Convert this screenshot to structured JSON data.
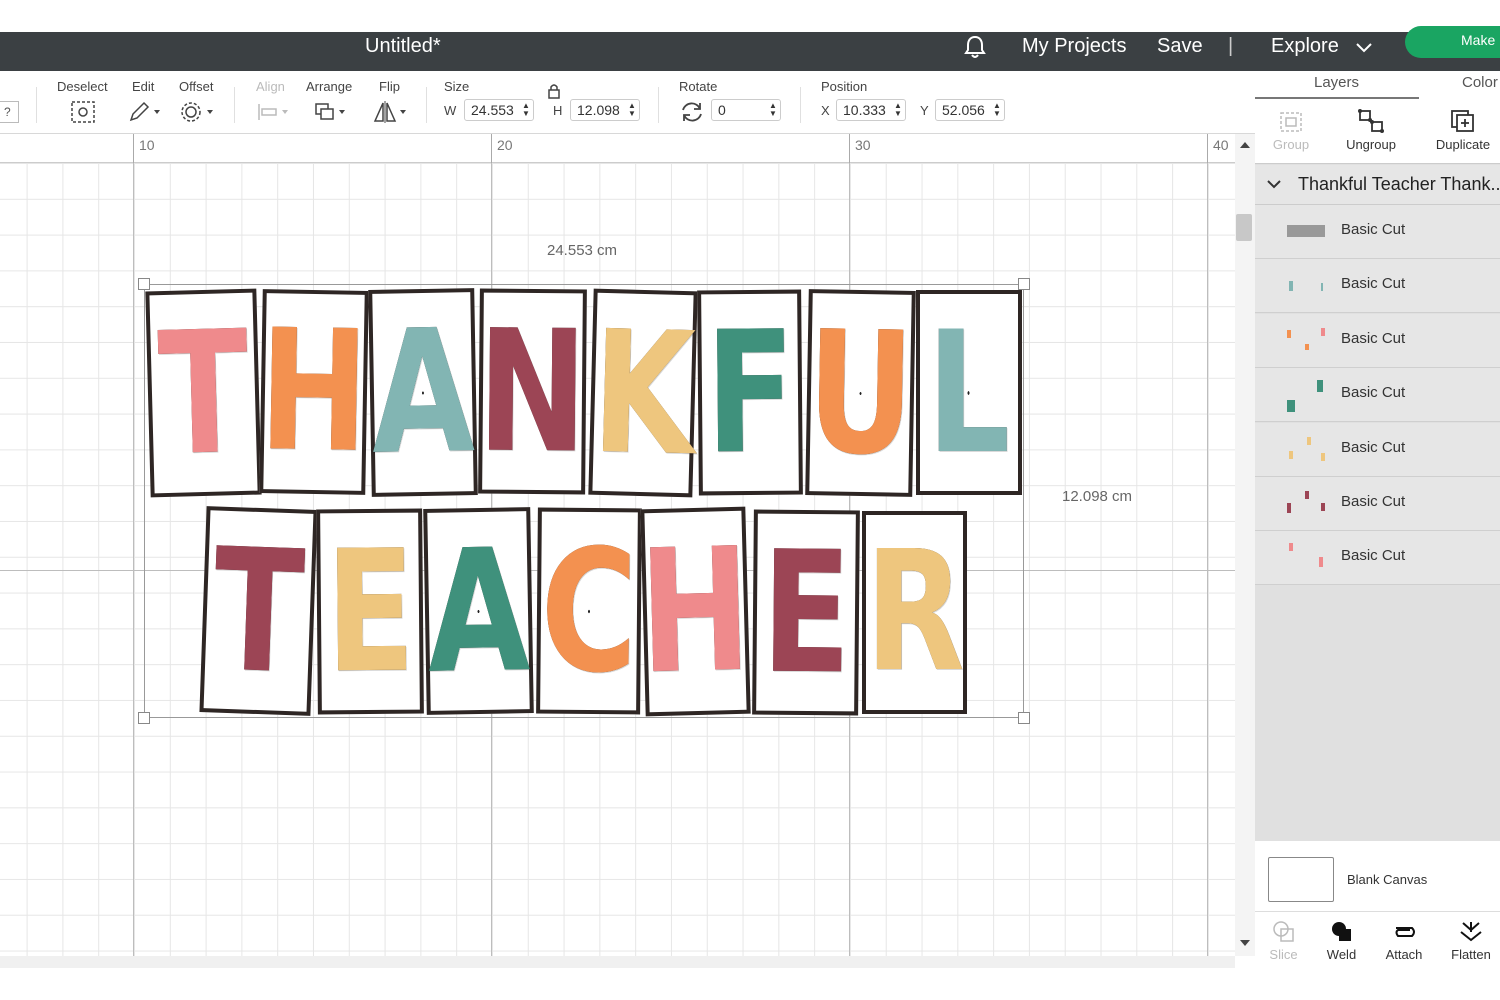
{
  "header": {
    "title": "Untitled*",
    "my_projects": "My Projects",
    "save": "Save",
    "explore": "Explore",
    "make": "Make"
  },
  "toolbar": {
    "help": "?",
    "deselect": "Deselect",
    "edit": "Edit",
    "offset": "Offset",
    "align": "Align",
    "arrange": "Arrange",
    "flip": "Flip",
    "size": "Size",
    "w_label": "W",
    "w_value": "24.553",
    "h_label": "H",
    "h_value": "12.098",
    "rotate": "Rotate",
    "rotate_value": "0",
    "position": "Position",
    "x_label": "X",
    "x_value": "10.333",
    "y_label": "Y",
    "y_value": "52.056"
  },
  "ruler": {
    "ticks": [
      "10",
      "20",
      "30",
      "40"
    ]
  },
  "canvas": {
    "width_label": "24.553 cm",
    "height_label": "12.098 cm",
    "word1": [
      "T",
      "H",
      "A",
      "N",
      "K",
      "F",
      "U",
      "L"
    ],
    "word1_colors": [
      "#ef8a8c",
      "#f39150",
      "#82b5b3",
      "#9c4555",
      "#eec67e",
      "#3f917c",
      "#f39150",
      "#82b5b3"
    ],
    "word2": [
      "T",
      "E",
      "A",
      "C",
      "H",
      "E",
      "R"
    ],
    "word2_colors": [
      "#9c4555",
      "#eec67e",
      "#3f917c",
      "#f39150",
      "#ef8a8c",
      "#9c4555",
      "#eec67e"
    ]
  },
  "panel": {
    "tab_layers": "Layers",
    "tab_color": "Color",
    "group": "Group",
    "ungroup": "Ungroup",
    "duplicate": "Duplicate",
    "group_name": "Thankful Teacher Thank...",
    "layers": [
      "Basic Cut",
      "Basic Cut",
      "Basic Cut",
      "Basic Cut",
      "Basic Cut",
      "Basic Cut",
      "Basic Cut"
    ],
    "blank_canvas": "Blank Canvas",
    "slice": "Slice",
    "weld": "Weld",
    "attach": "Attach",
    "flatten": "Flatten"
  },
  "colors": {
    "header_bg": "#3b4043",
    "make_green": "#1aa562"
  }
}
